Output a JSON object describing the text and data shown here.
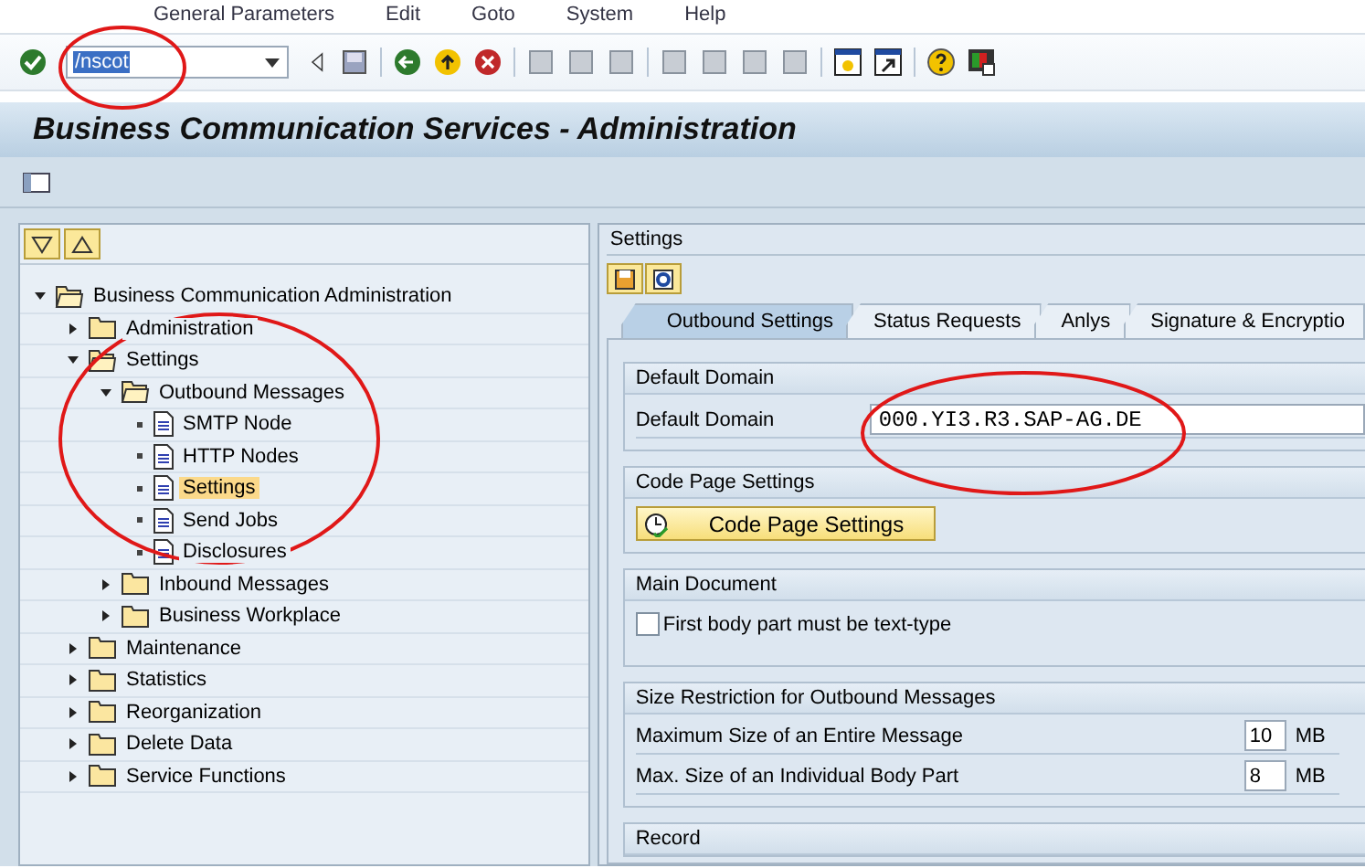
{
  "menu_bar": [
    "General Parameters",
    "Edit",
    "Goto",
    "System",
    "Help"
  ],
  "command_field": {
    "value": "/nscot"
  },
  "title": "Business Communication Services - Administration",
  "tree": [
    {
      "label": "Business Communication Administration",
      "kind": "folder",
      "expanded": true,
      "selected": false,
      "children": [
        {
          "label": "Administration",
          "kind": "folder",
          "expanded": false,
          "selected": false
        },
        {
          "label": "Settings",
          "kind": "folder",
          "expanded": true,
          "selected": false,
          "children": [
            {
              "label": "Outbound Messages",
              "kind": "folder",
              "expanded": true,
              "selected": false,
              "children": [
                {
                  "label": "SMTP Node",
                  "kind": "doc",
                  "selected": false
                },
                {
                  "label": "HTTP Nodes",
                  "kind": "doc",
                  "selected": false
                },
                {
                  "label": "Settings",
                  "kind": "doc",
                  "selected": true
                },
                {
                  "label": "Send Jobs",
                  "kind": "doc",
                  "selected": false
                },
                {
                  "label": "Disclosures",
                  "kind": "doc",
                  "selected": false
                }
              ]
            },
            {
              "label": "Inbound Messages",
              "kind": "folder",
              "expanded": false,
              "selected": false
            },
            {
              "label": "Business Workplace",
              "kind": "folder",
              "expanded": false,
              "selected": false
            }
          ]
        },
        {
          "label": "Maintenance",
          "kind": "folder",
          "expanded": false,
          "selected": false
        },
        {
          "label": "Statistics",
          "kind": "folder",
          "expanded": false,
          "selected": false
        },
        {
          "label": "Reorganization",
          "kind": "folder",
          "expanded": false,
          "selected": false
        },
        {
          "label": "Delete Data",
          "kind": "folder",
          "expanded": false,
          "selected": false
        },
        {
          "label": "Service Functions",
          "kind": "folder",
          "expanded": false,
          "selected": false
        }
      ]
    }
  ],
  "panel": {
    "title": "Settings",
    "tabs": [
      {
        "label": "Outbound Settings",
        "selected": true
      },
      {
        "label": "Status Requests",
        "selected": false
      },
      {
        "label": "Anlys",
        "selected": false
      },
      {
        "label": "Signature & Encryptio",
        "selected": false
      }
    ],
    "sections": [
      {
        "kind": "field",
        "title": "Default Domain",
        "label": "Default Domain",
        "value": "000.YI3.R3.SAP-AG.DE"
      },
      {
        "kind": "button",
        "title": "Code Page Settings",
        "button": "Code Page Settings"
      },
      {
        "kind": "checkbox",
        "title": "Main Document",
        "label": "First body part must be text-type",
        "checked": false
      },
      {
        "kind": "sizes",
        "title": "Size Restriction for Outbound Messages",
        "rows": [
          {
            "label": "Maximum Size of an Entire Message",
            "value": "10",
            "unit": "MB"
          },
          {
            "label": "Max. Size of an Individual Body Part",
            "value": "8",
            "unit": "MB"
          }
        ]
      },
      {
        "kind": "heading",
        "title": "Record"
      }
    ]
  }
}
